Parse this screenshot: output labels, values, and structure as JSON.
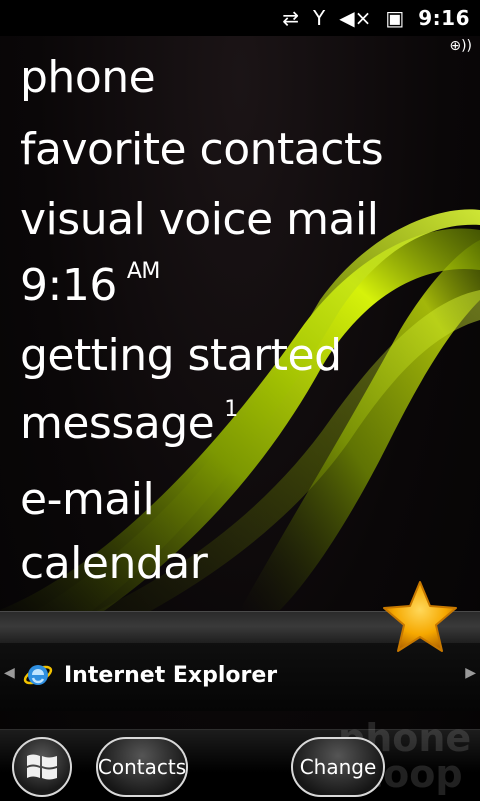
{
  "status_bar": {
    "data_icon": "⇄",
    "signal_icon": "Y",
    "volume_icon": "◀×",
    "battery_icon": "▣",
    "time": "9:16",
    "gps_icon": "⊕))"
  },
  "menu": {
    "items": [
      {
        "label": "phone"
      },
      {
        "label": "favorite contacts"
      },
      {
        "label": "visual voice mail"
      },
      {
        "label": "9:16",
        "suffix": "AM"
      },
      {
        "label": "getting started"
      },
      {
        "label": "message",
        "suffix": "1"
      },
      {
        "label": "e-mail"
      },
      {
        "label": "calendar"
      }
    ]
  },
  "ie_bar": {
    "label": "Internet Explorer",
    "left_arrow": "◀",
    "right_arrow": "▶"
  },
  "bottom_bar": {
    "contacts_label": "Contacts",
    "change_label": "Change"
  },
  "watermark": {
    "line1": "phone",
    "line2": "scoop"
  },
  "colors": {
    "wave": "#b6d900",
    "star": "#f6a800"
  }
}
